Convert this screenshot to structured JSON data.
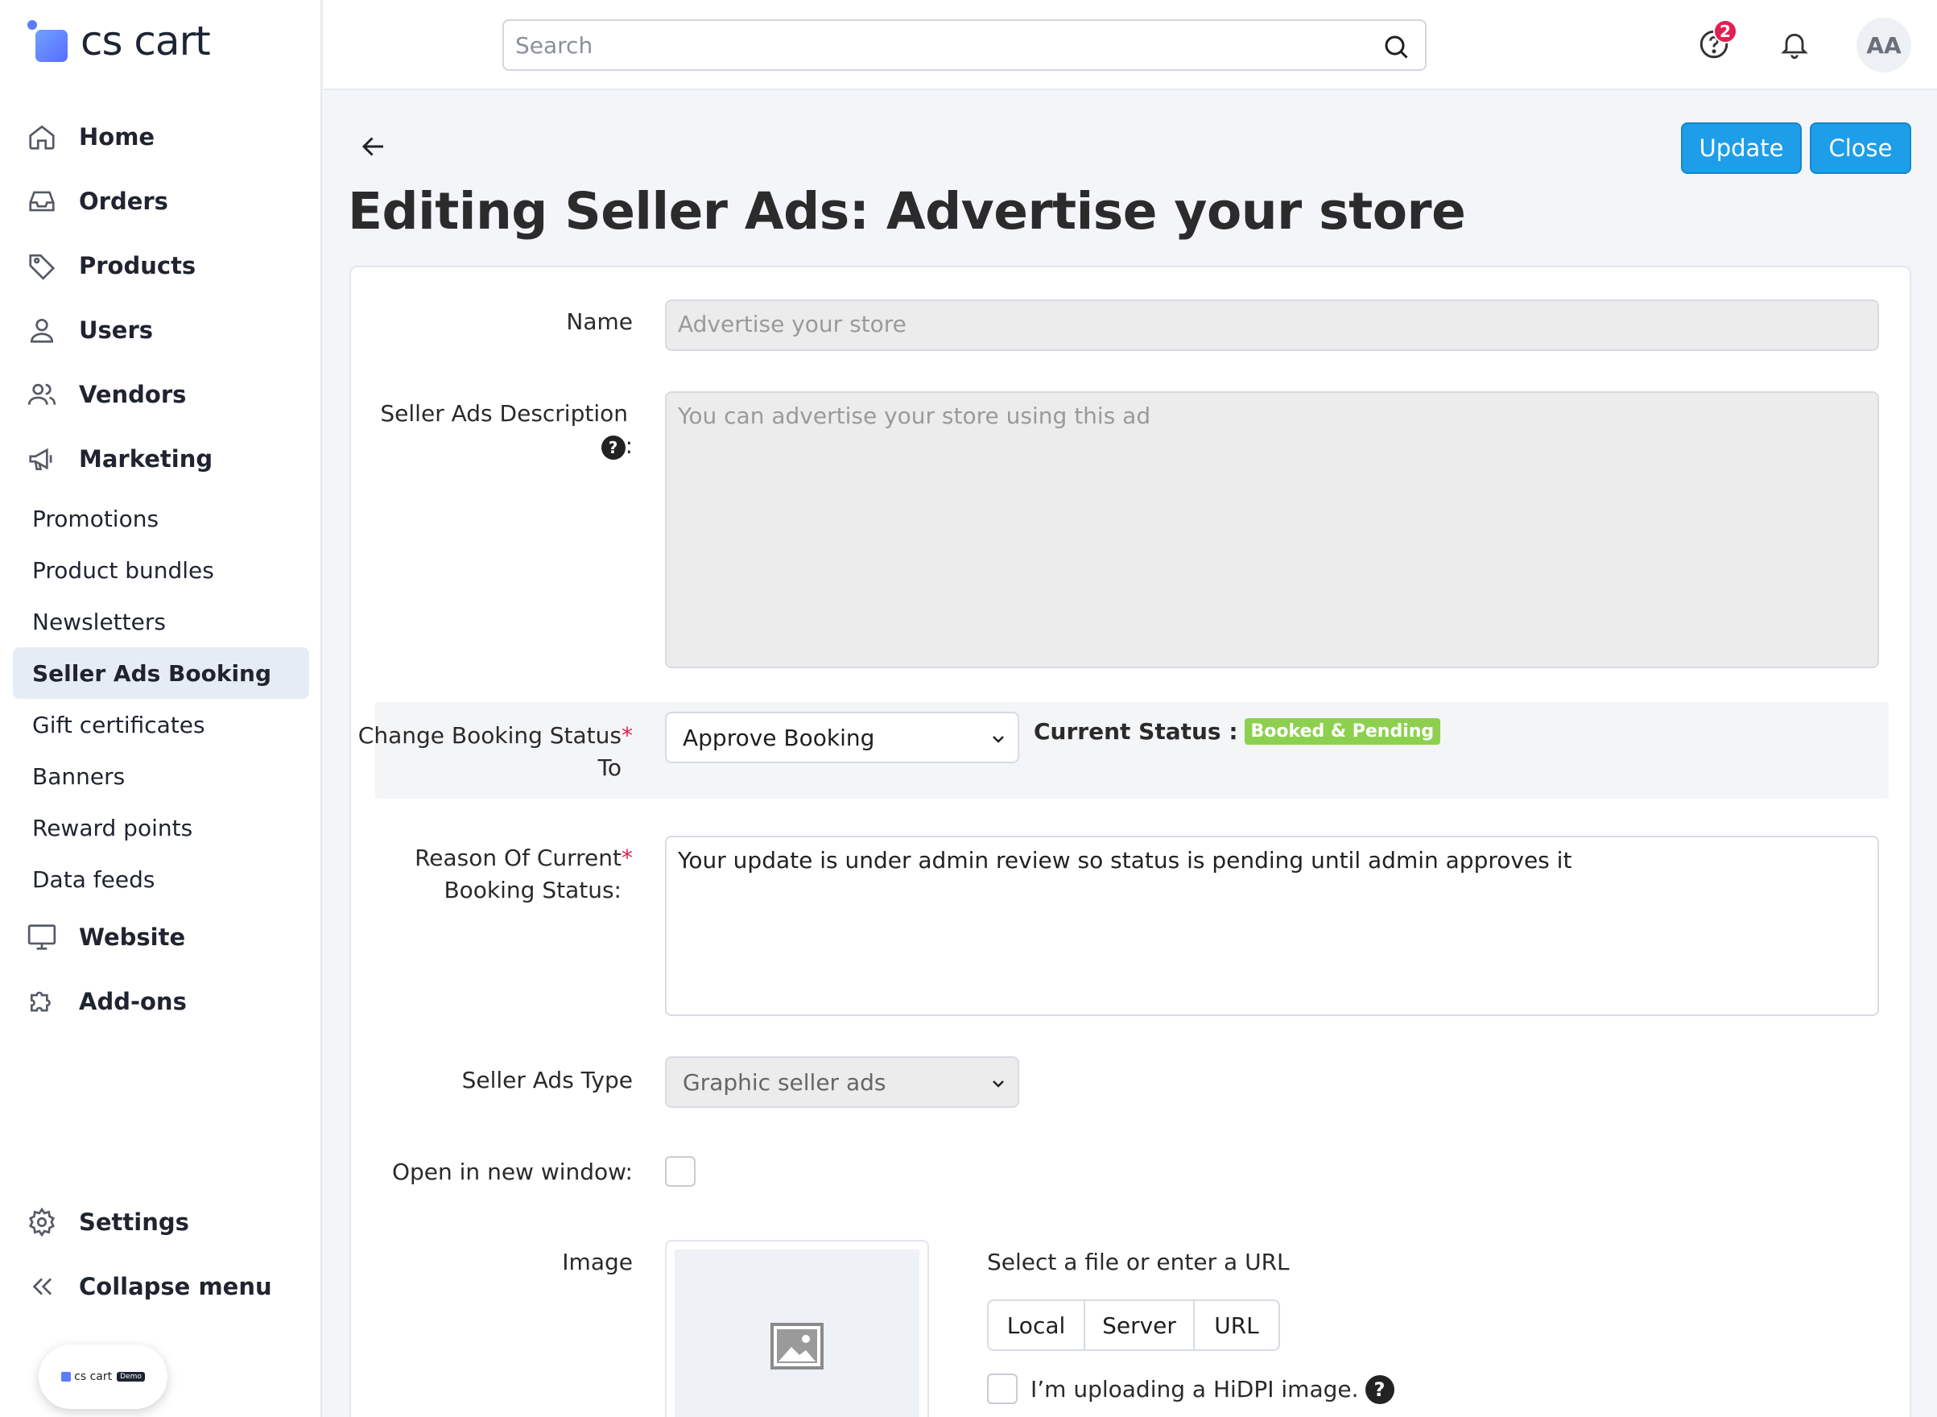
{
  "app": {
    "logo_text": "cs cart",
    "demo_badge_text": "cs cart",
    "demo_tag": "Demo"
  },
  "sidebar": {
    "items": [
      {
        "label": "Home",
        "icon": "home-icon"
      },
      {
        "label": "Orders",
        "icon": "inbox-icon"
      },
      {
        "label": "Products",
        "icon": "tag-icon"
      },
      {
        "label": "Users",
        "icon": "user-icon"
      },
      {
        "label": "Vendors",
        "icon": "users-icon"
      },
      {
        "label": "Marketing",
        "icon": "megaphone-icon"
      }
    ],
    "marketing_sub": [
      "Promotions",
      "Product bundles",
      "Newsletters",
      "Seller Ads Booking",
      "Gift certificates",
      "Banners",
      "Reward points",
      "Data feeds"
    ],
    "active_sub": "Seller Ads Booking",
    "more_items": [
      {
        "label": "Website",
        "icon": "monitor-icon"
      },
      {
        "label": "Add-ons",
        "icon": "puzzle-icon"
      }
    ],
    "bottom": [
      {
        "label": "Settings",
        "icon": "gear-icon"
      },
      {
        "label": "Collapse menu",
        "icon": "chevrons-left-icon"
      }
    ]
  },
  "header": {
    "search_placeholder": "Search",
    "help_badge_count": "2",
    "avatar_initials": "AA"
  },
  "page": {
    "title": "Editing Seller Ads: Advertise your store",
    "update_label": "Update",
    "close_label": "Close"
  },
  "form": {
    "name_label": "Name",
    "name_value": "Advertise your store",
    "desc_label": "Seller Ads Description",
    "desc_colon": ":",
    "desc_value": "You can advertise your store using this ad",
    "change_status_label_line1": "Change Booking Status",
    "change_status_label_line2": "To",
    "change_status_value": "Approve Booking",
    "current_status_label": "Current Status :",
    "current_status_value": "Booked & Pending",
    "reason_label_line1": "Reason Of Current",
    "reason_label_line2": "Booking Status:",
    "reason_value": "Your update is under admin review so status is pending until admin approves it",
    "type_label": "Seller Ads Type",
    "type_value": "Graphic seller ads",
    "new_window_label": "Open in new window:",
    "image_label": "Image",
    "file_prompt": "Select a file or enter a URL",
    "source_options": [
      "Local",
      "Server",
      "URL"
    ],
    "hidpi_label": "I’m uploading a HiDPI image.",
    "required_mark": "*"
  },
  "colors": {
    "accent": "#1e9ee8",
    "status_badge": "#8dd04f",
    "notification": "#e0204e"
  }
}
